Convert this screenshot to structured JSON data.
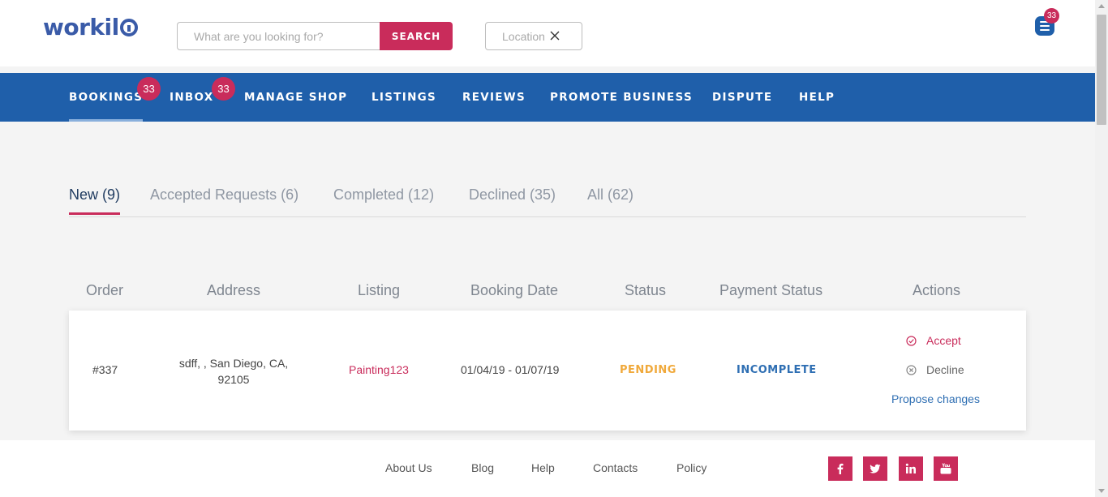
{
  "header": {
    "logo": "workilo",
    "search_placeholder": "What are you looking for?",
    "search_button": "SEARCH",
    "location_label": "Location",
    "menu_badge": "33"
  },
  "nav": {
    "items": [
      {
        "label": "BOOKINGS",
        "active": true,
        "badge": "33"
      },
      {
        "label": "INBOX",
        "badge": "33"
      },
      {
        "label": "MANAGE SHOP"
      },
      {
        "label": "LISTINGS"
      },
      {
        "label": "REVIEWS"
      },
      {
        "label": "PROMOTE BUSINESS"
      },
      {
        "label": "DISPUTE"
      },
      {
        "label": "HELP"
      }
    ]
  },
  "tabs": [
    {
      "label": "New (9)",
      "active": true
    },
    {
      "label": "Accepted Requests (6)"
    },
    {
      "label": "Completed (12)"
    },
    {
      "label": "Declined (35)"
    },
    {
      "label": "All (62)"
    }
  ],
  "table": {
    "headers": [
      "Order",
      "Address",
      "Listing",
      "Booking Date",
      "Status",
      "Payment Status",
      "Actions"
    ],
    "rows": [
      {
        "order": "#337",
        "address_line1": "sdff, , San Diego, CA,",
        "address_line2": "92105",
        "listing": "Painting123",
        "booking_date": "01/04/19 - 01/07/19",
        "status": "PENDING",
        "payment_status": "INCOMPLETE",
        "actions": {
          "accept": "Accept",
          "decline": "Decline",
          "propose": "Propose changes"
        }
      }
    ]
  },
  "footer": {
    "links": [
      "About Us",
      "Blog",
      "Help",
      "Contacts",
      "Policy"
    ],
    "social": [
      "facebook-icon",
      "twitter-icon",
      "linkedin-icon",
      "youtube-icon"
    ]
  },
  "colors": {
    "brand_blue": "#1f5faa",
    "accent_pink": "#c92c5b",
    "pending_orange": "#f0a93b"
  }
}
